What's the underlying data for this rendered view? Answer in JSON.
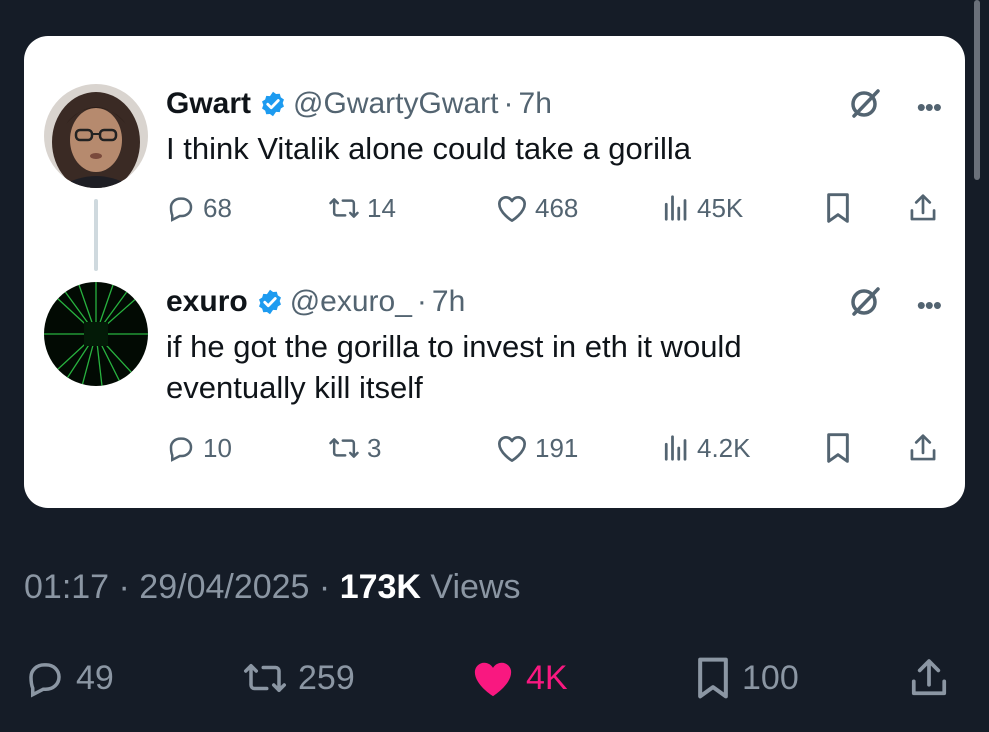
{
  "tweets": [
    {
      "name": "Gwart",
      "handle": "@GwartyGwart",
      "separator": "·",
      "time": "7h",
      "text": "I think Vitalik alone could take a gorilla",
      "replies": "68",
      "retweets": "14",
      "likes": "468",
      "views": "45K"
    },
    {
      "name": "exuro",
      "handle": "@exuro_",
      "separator": "·",
      "time": "7h",
      "text": "if he got the gorilla to invest in eth it would eventually kill itself",
      "replies": "10",
      "retweets": "3",
      "likes": "191",
      "views": "4.2K"
    }
  ],
  "meta": {
    "timestamp": "01:17 · 29/04/2025 · ",
    "views_count": "173K",
    "views_label": " Views"
  },
  "stats": {
    "replies": "49",
    "retweets": "259",
    "likes": "4K",
    "bookmarks": "100"
  },
  "colors": {
    "background": "#151c27",
    "card": "#ffffff",
    "verified": "#1d9bf0",
    "like_active": "#f91880",
    "muted": "#536471"
  },
  "icons": {
    "verified": "verified-badge-icon",
    "grok": "grok-icon",
    "more": "more-icon",
    "reply": "reply-icon",
    "retweet": "retweet-icon",
    "like": "heart-icon",
    "views": "views-icon",
    "bookmark": "bookmark-icon",
    "share": "share-icon"
  }
}
